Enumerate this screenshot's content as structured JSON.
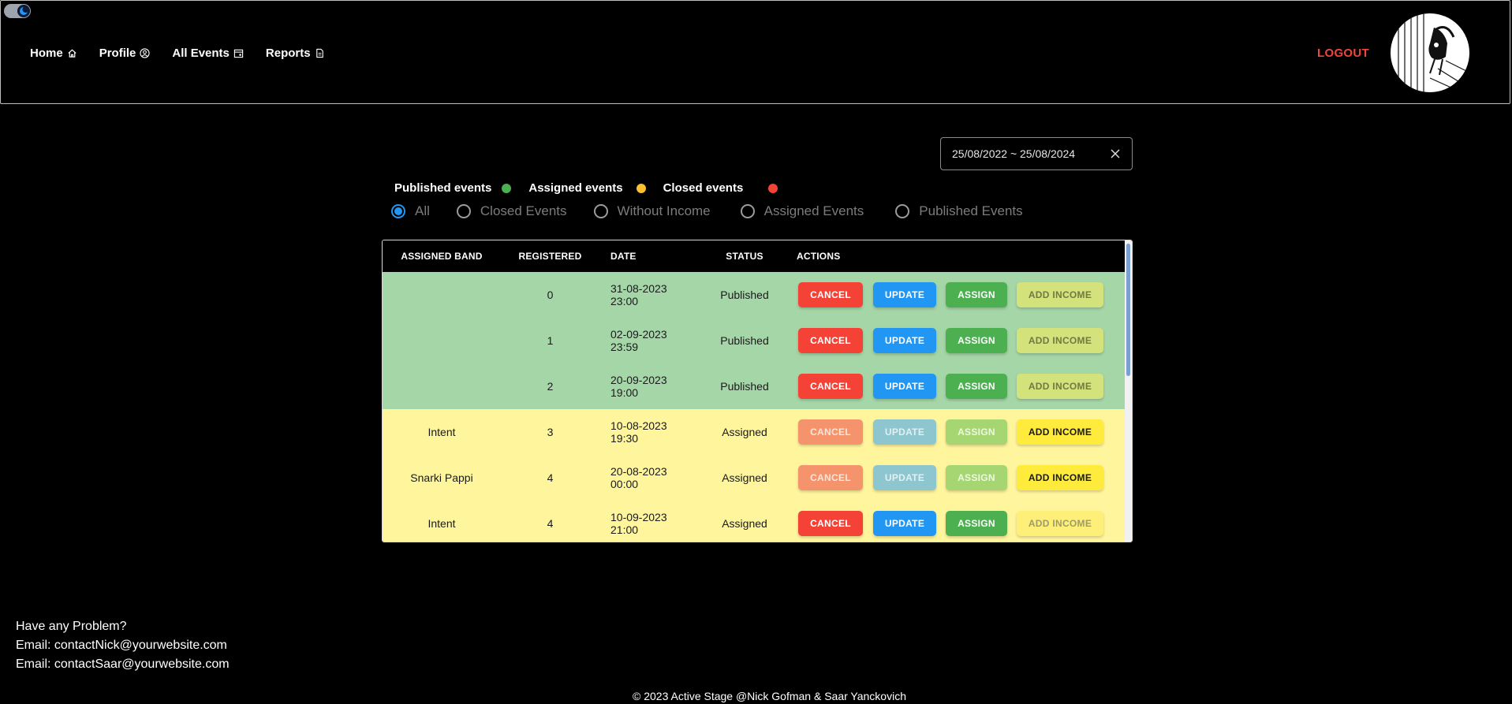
{
  "header": {
    "nav": [
      {
        "label": "Home",
        "icon": "home-icon"
      },
      {
        "label": "Profile",
        "icon": "user-circle-icon"
      },
      {
        "label": "All Events",
        "icon": "calendar-icon"
      },
      {
        "label": "Reports",
        "icon": "document-icon"
      }
    ],
    "logout_label": "LOGOUT"
  },
  "date_range": {
    "value": "25/08/2022 ~ 25/08/2024"
  },
  "legend": {
    "items": [
      {
        "label": "Published events",
        "color": "#4caf50"
      },
      {
        "label": "Assigned events",
        "color": "#fbc02d"
      },
      {
        "label": "Closed events",
        "color": "#f44336"
      }
    ]
  },
  "filters": {
    "options": [
      "All",
      "Closed Events",
      "Without Income",
      "Assigned Events",
      "Published Events"
    ],
    "selected": "All"
  },
  "table": {
    "headers": [
      "ASSIGNED BAND",
      "REGISTERED",
      "DATE",
      "STATUS",
      "ACTIONS"
    ],
    "actions": {
      "cancel": "CANCEL",
      "update": "UPDATE",
      "assign": "ASSIGN",
      "income": "ADD INCOME"
    },
    "rows": [
      {
        "band": "",
        "registered": "0",
        "date": "31-08-2023 23:00",
        "status": "Published"
      },
      {
        "band": "",
        "registered": "1",
        "date": "02-09-2023 23:59",
        "status": "Published"
      },
      {
        "band": "",
        "registered": "2",
        "date": "20-09-2023 19:00",
        "status": "Published"
      },
      {
        "band": "Intent",
        "registered": "3",
        "date": "10-08-2023 19:30",
        "status": "Assigned"
      },
      {
        "band": "Snarki Pappi",
        "registered": "4",
        "date": "20-08-2023 00:00",
        "status": "Assigned"
      },
      {
        "band": "Intent",
        "registered": "4",
        "date": "10-09-2023 21:00",
        "status": "Assigned"
      }
    ]
  },
  "footer": {
    "problem": "Have any Problem?",
    "email1": "Email: contactNick@yourwebsite.com",
    "email2": "Email: contactSaar@yourwebsite.com",
    "copyright": "© 2023 Active Stage @Nick Gofman & Saar Yanckovich"
  }
}
